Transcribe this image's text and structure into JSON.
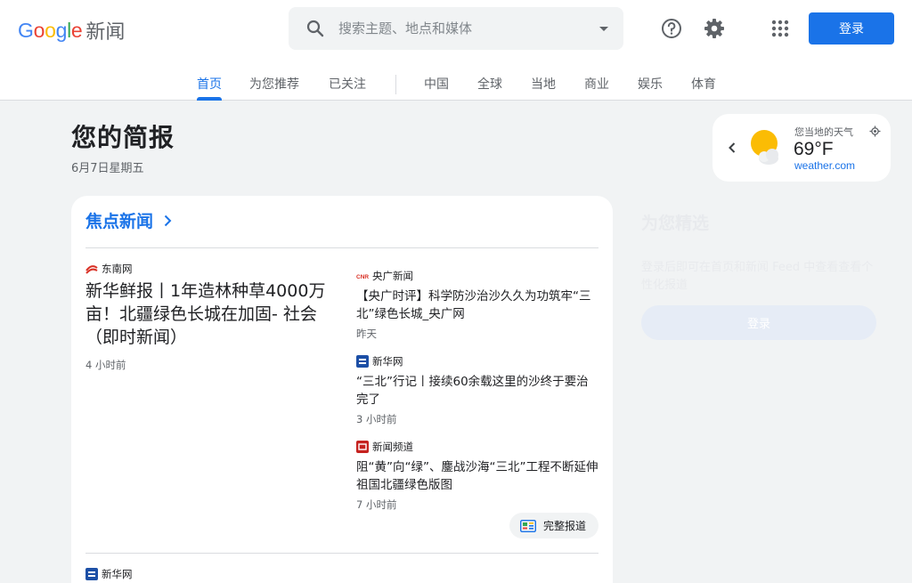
{
  "header": {
    "logo_text": "Google",
    "logo_suffix": "新闻",
    "search_placeholder": "搜索主题、地点和媒体",
    "login_label": "登录"
  },
  "tabs": [
    {
      "label": "首页",
      "active": true
    },
    {
      "label": "为您推荐"
    },
    {
      "label": "已关注"
    },
    {
      "label": "中国"
    },
    {
      "label": "全球"
    },
    {
      "label": "当地"
    },
    {
      "label": "商业"
    },
    {
      "label": "娱乐"
    },
    {
      "label": "体育"
    }
  ],
  "briefing": {
    "title": "您的简报",
    "date": "6月7日星期五"
  },
  "weather": {
    "label": "您当地的天气",
    "temp": "69°F",
    "source": "weather.com"
  },
  "top_stories": {
    "title": "焦点新闻",
    "main": {
      "source": "东南网",
      "headline": "新华鲜报丨1年造林种草4000万亩！北疆绿色长城在加固- 社会（即时新闻）",
      "time": "4 小时前"
    },
    "side": [
      {
        "source": "央广新闻",
        "logo": "CNR",
        "headline": "【央广时评】科学防沙治沙久久为功筑牢“三北”绿色长城_央广网",
        "time": "昨天"
      },
      {
        "source": "新华网",
        "headline": "“三北”行记丨接续60余载这里的沙终于要治完了",
        "time": "3 小时前"
      },
      {
        "source": "新闻频道",
        "headline": "阻“黄”向“绿”、鏖战沙海“三北”工程不断延伸祖国北疆绿色版图",
        "time": "7 小时前"
      }
    ],
    "full_coverage_label": "完整报道",
    "next_source": "新华网"
  },
  "picks": {
    "title": "为您精选",
    "text": "登录后即可在首页和新闻 Feed 中查看查看个性化报道",
    "button": "登录"
  },
  "colors": {
    "accent": "#1a73e8",
    "background": "#f1f3f4"
  }
}
